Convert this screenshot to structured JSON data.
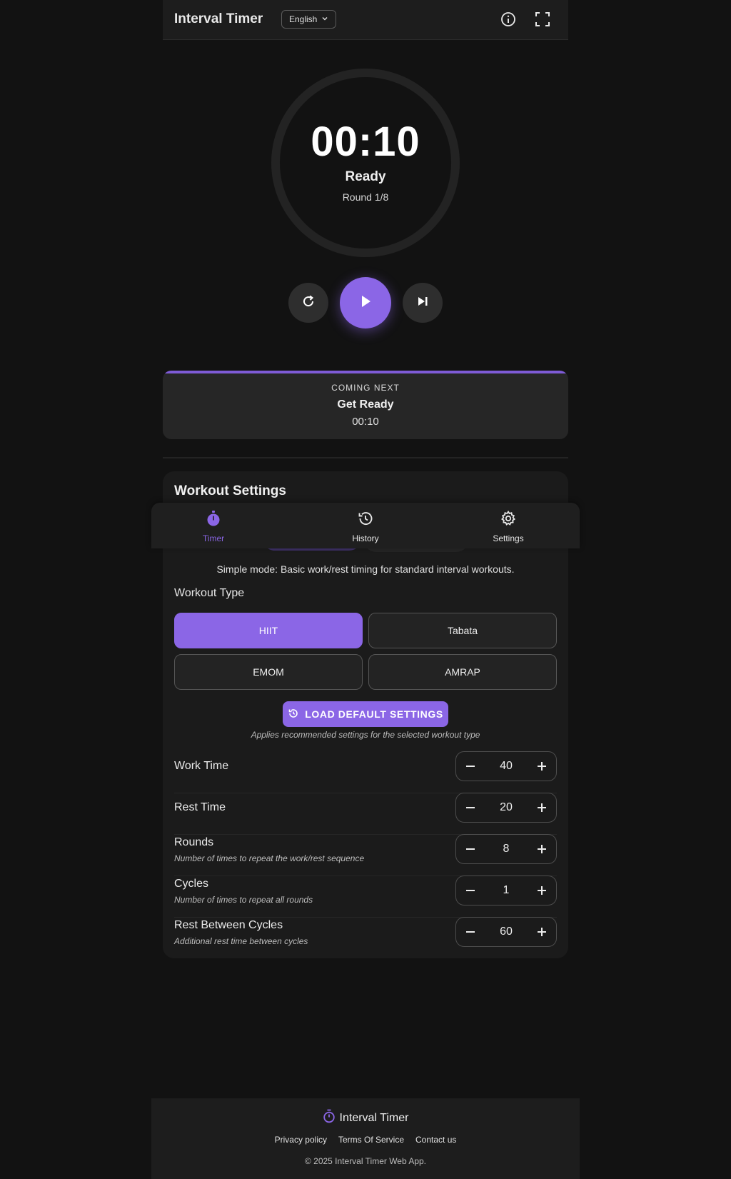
{
  "header": {
    "title": "Interval Timer",
    "language": "English",
    "icons": {
      "info": "info-icon",
      "fullscreen": "fullscreen-icon",
      "chevron": "chevron-down-icon"
    }
  },
  "timer": {
    "time": "00:10",
    "state": "Ready",
    "round": "Round 1/8",
    "controls": {
      "reset": "reset-icon",
      "play": "play-icon",
      "skip": "skip-next-icon"
    }
  },
  "next_up": {
    "label": "COMING NEXT",
    "phase": "Get Ready",
    "time": "00:10"
  },
  "settings": {
    "title": "Workout Settings",
    "mode_description": "Simple mode: Basic work/rest timing for standard interval workouts.",
    "workout_type_label": "Workout Type",
    "workout_types": [
      "HIIT",
      "Tabata",
      "EMOM",
      "AMRAP"
    ],
    "selected_type": "HIIT",
    "load_defaults_label": "LOAD DEFAULT SETTINGS",
    "load_defaults_note": "Applies recommended settings for the selected workout type",
    "fields": [
      {
        "label": "Work Time",
        "description": "",
        "value": "40"
      },
      {
        "label": "Rest Time",
        "description": "",
        "value": "20"
      },
      {
        "label": "Rounds",
        "description": "Number of times to repeat the work/rest sequence",
        "value": "8"
      },
      {
        "label": "Cycles",
        "description": "Number of times to repeat all rounds",
        "value": "1"
      },
      {
        "label": "Rest Between Cycles",
        "description": "Additional rest time between cycles",
        "value": "60"
      }
    ]
  },
  "bottom_nav": {
    "items": [
      {
        "label": "Timer",
        "icon": "stopwatch-icon",
        "active": true
      },
      {
        "label": "History",
        "icon": "history-icon",
        "active": false
      },
      {
        "label": "Settings",
        "icon": "gear-icon",
        "active": false
      }
    ]
  },
  "footer": {
    "brand": "Interval Timer",
    "links": [
      "Privacy policy",
      "Terms Of Service",
      "Contact us"
    ],
    "copyright": "© 2025 Interval Timer Web App."
  },
  "colors": {
    "accent": "#8b66e6",
    "background": "#121212",
    "surface": "#1b1b1b"
  }
}
